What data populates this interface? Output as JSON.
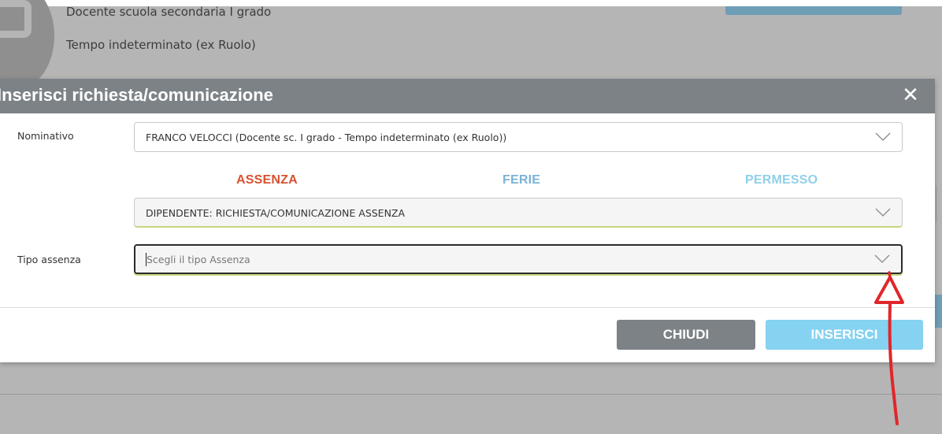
{
  "background": {
    "role_line": "Docente scuola secondaria I grado",
    "contract_line": "Tempo indeterminato (ex Ruolo)"
  },
  "modal": {
    "title": "Inserisci richiesta/comunicazione",
    "close_icon": "close-icon",
    "nominativo": {
      "label": "Nominativo",
      "value": "FRANCO VELOCCI (Docente sc. I grado - Tempo indeterminato (ex Ruolo))"
    },
    "tabs": [
      {
        "label": "ASSENZA",
        "color": "#d9502e",
        "active": true
      },
      {
        "label": "FERIE",
        "color": "#7bb3d6",
        "active": false
      },
      {
        "label": "PERMESSO",
        "color": "#8fd0ea",
        "active": false
      }
    ],
    "request_type": {
      "value": "DIPENDENTE: RICHIESTA/COMUNICAZIONE ASSENZA"
    },
    "tipo_assenza": {
      "label": "Tipo assenza",
      "placeholder": "Scegli il tipo Assenza"
    },
    "buttons": {
      "close_label": "CHIUDI",
      "insert_label": "INSERISCI"
    }
  },
  "colors": {
    "header": "#7d8287",
    "close_button": "#7d8287",
    "insert_button": "#86d2f1",
    "annotation_arrow": "#e0262b"
  }
}
